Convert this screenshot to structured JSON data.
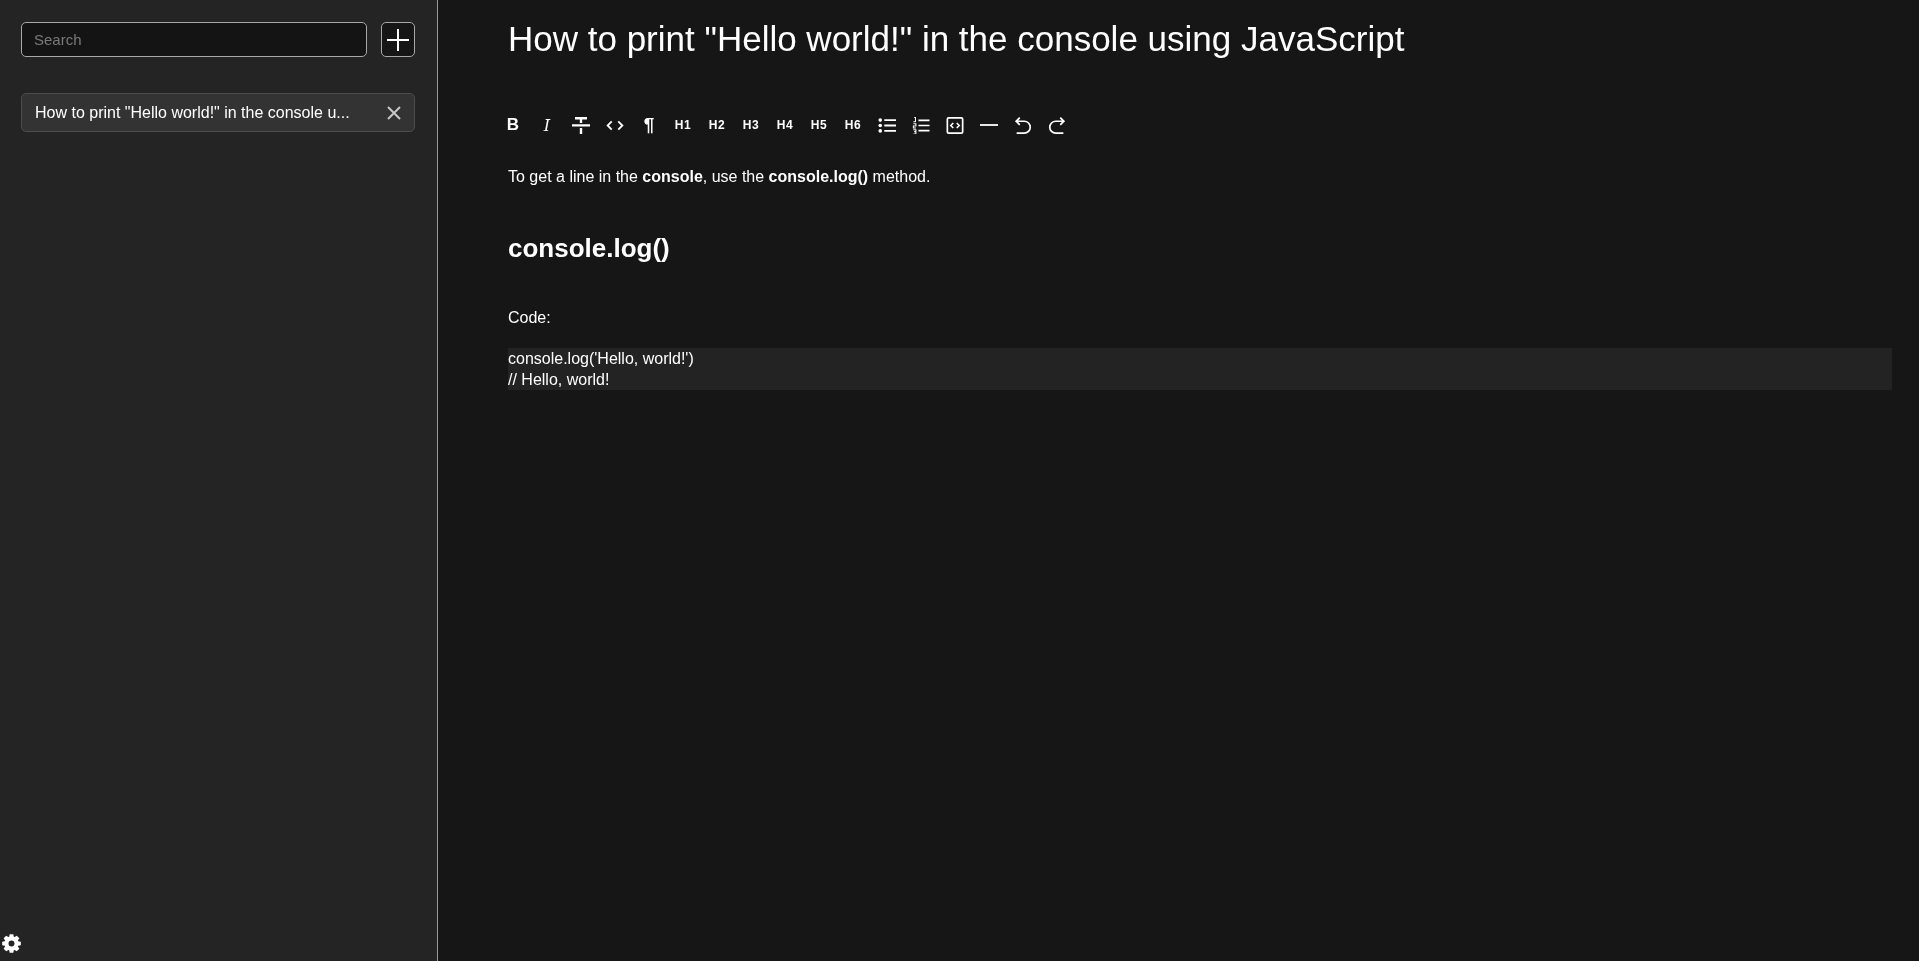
{
  "sidebar": {
    "search": {
      "placeholder": "Search"
    },
    "notes": [
      {
        "title": "How to print \"Hello world!\" in the console u...",
        "selected": true
      }
    ]
  },
  "editor": {
    "title": "How to print \"Hello world!\" in the console using JavaScript",
    "toolbar": [
      {
        "kind": "bold",
        "label": "B"
      },
      {
        "kind": "italic",
        "label": "I"
      },
      {
        "kind": "strike"
      },
      {
        "kind": "code"
      },
      {
        "kind": "paragraph",
        "label": "¶"
      },
      {
        "kind": "heading",
        "label": "H1"
      },
      {
        "kind": "heading",
        "label": "H2"
      },
      {
        "kind": "heading",
        "label": "H3"
      },
      {
        "kind": "heading",
        "label": "H4"
      },
      {
        "kind": "heading",
        "label": "H5"
      },
      {
        "kind": "heading",
        "label": "H6"
      },
      {
        "kind": "bullet_list"
      },
      {
        "kind": "ordered_list"
      },
      {
        "kind": "code_block"
      },
      {
        "kind": "horizontal_rule"
      },
      {
        "kind": "undo"
      },
      {
        "kind": "redo"
      }
    ],
    "content": [
      {
        "kind": "paragraph",
        "text": "To get a line in the **console**, use the **console.log()** method."
      },
      {
        "kind": "heading",
        "text": "console.log()"
      },
      {
        "kind": "paragraph",
        "text": "Code:"
      },
      {
        "kind": "code_block",
        "lines": [
          "console.log('Hello, world!')",
          "// Hello, world!"
        ]
      }
    ]
  }
}
